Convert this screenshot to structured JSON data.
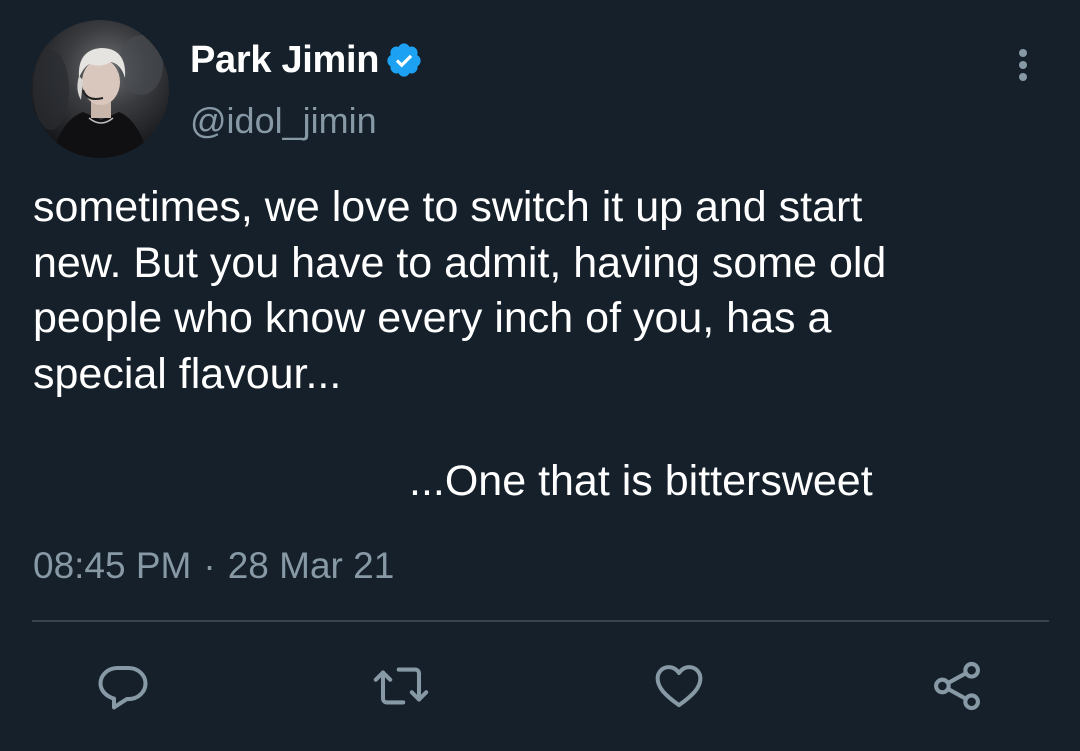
{
  "author": {
    "display_name": "Park Jimin",
    "handle": "@idol_jimin",
    "verified": true
  },
  "tweet": {
    "text": "sometimes, we love to switch it up and start\nnew. But you have to admit, having some old\npeople who know every inch of you, has a\nspecial flavour...",
    "text_tail": "...One that is bittersweet",
    "time": "08:45 PM",
    "separator": "·",
    "date": "28 Mar 21"
  },
  "icons": {
    "avatar": "profile-photo",
    "verified": "verified-badge-icon",
    "more": "more-vertical-icon",
    "reply": "reply-icon",
    "retweet": "retweet-icon",
    "like": "heart-icon",
    "share": "share-icon"
  },
  "colors": {
    "background": "#15202b",
    "text": "#ffffff",
    "muted": "#8899a6",
    "divider": "#38444d",
    "verified": "#1da1f2"
  }
}
